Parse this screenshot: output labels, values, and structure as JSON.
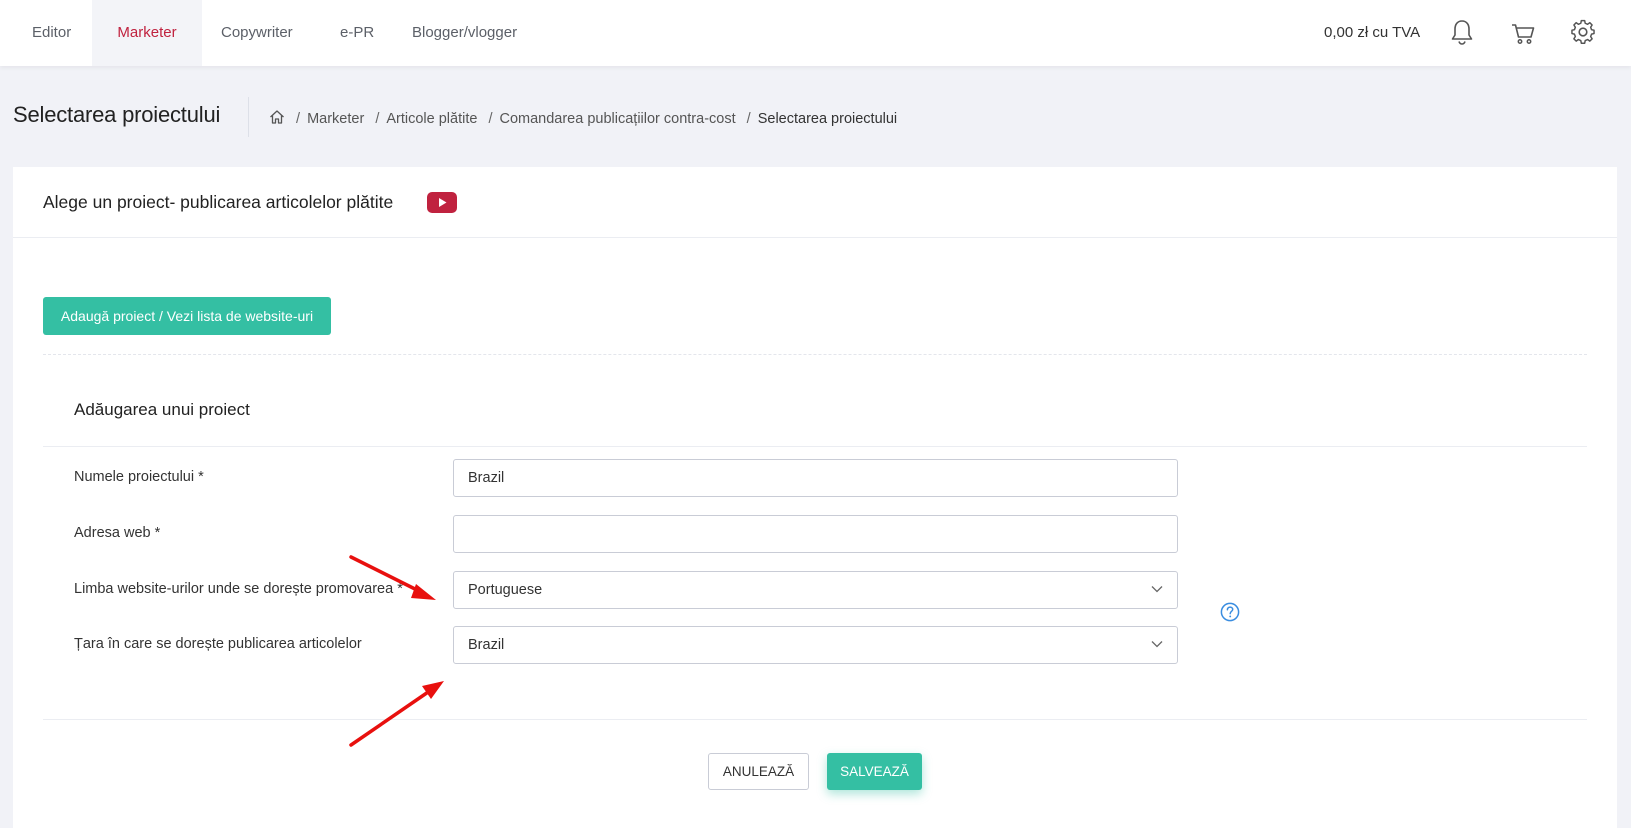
{
  "nav": {
    "tabs": [
      {
        "label": "Editor"
      },
      {
        "label": "Marketer",
        "active": true
      },
      {
        "label": "Copywriter"
      },
      {
        "label": "e-PR"
      },
      {
        "label": "Blogger/vlogger"
      }
    ],
    "price": "0,00 zł cu TVA",
    "icons": [
      "bell-icon",
      "cart-icon",
      "gear-icon"
    ]
  },
  "page": {
    "title": "Selectarea proiectului",
    "breadcrumb": [
      "Marketer",
      "Articole plătite",
      "Comandarea publicațiilor contra-cost",
      "Selectarea proiectului"
    ],
    "breadcrumb_separator": "/"
  },
  "card": {
    "title": "Alege un proiect- publicarea articolelor plătite",
    "add_button": "Adaugă proiect / Vezi lista de website-uri",
    "section_title": "Adăugarea unui proiect",
    "fields": {
      "project_name": {
        "label": "Numele proiectului *",
        "value": "Brazil"
      },
      "web_address": {
        "label": "Adresa web *",
        "value": ""
      },
      "language": {
        "label": "Limba website-urilor unde se dorește promovarea *",
        "value": "Portuguese"
      },
      "country": {
        "label": "Țara în care se dorește publicarea articolelor",
        "value": "Brazil"
      }
    },
    "cancel_button": "ANULEAZĂ",
    "save_button": "SALVEAZĂ"
  },
  "colors": {
    "accent": "#c0223f",
    "primary_button": "#34bfa3",
    "youtube_red": "#c0223f",
    "annotation_arrow": "#e8100e",
    "help_icon": "#3a8de0"
  }
}
